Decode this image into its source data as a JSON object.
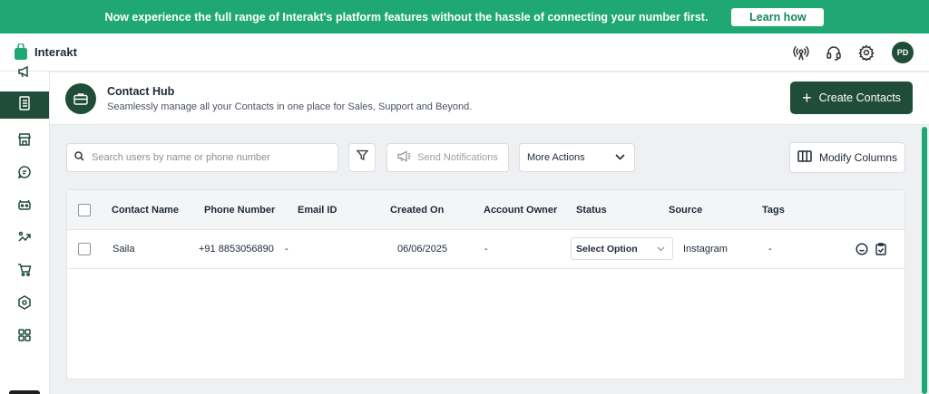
{
  "banner": {
    "text": "Now experience the full range of Interakt's platform features without the hassle of connecting your number first.",
    "cta": "Learn how"
  },
  "app": {
    "name": "Interakt"
  },
  "user": {
    "initials": "PD"
  },
  "topbar": {
    "icons": [
      "broadcast-icon",
      "headset-icon",
      "gear-icon"
    ]
  },
  "sidebar": {
    "items": [
      {
        "icon": "campaign-icon",
        "active": false
      },
      {
        "icon": "contacts-book-icon",
        "active": true
      },
      {
        "icon": "store-icon",
        "active": false
      },
      {
        "icon": "chat-icon",
        "active": false
      },
      {
        "icon": "bot-icon",
        "active": false
      },
      {
        "icon": "growth-icon",
        "active": false
      },
      {
        "icon": "cart-icon",
        "active": false
      },
      {
        "icon": "integration-hexagon-icon",
        "active": false
      },
      {
        "icon": "apps-grid-icon",
        "active": false
      }
    ]
  },
  "header": {
    "title": "Contact Hub",
    "subtitle": "Seamlessly manage all your Contacts in one place for Sales, Support and Beyond.",
    "create_button": "Create Contacts"
  },
  "toolbar": {
    "search_placeholder": "Search users by name or phone number",
    "send_notifications": "Send Notifications",
    "more_actions": "More Actions",
    "modify_columns": "Modify Columns"
  },
  "table": {
    "columns": [
      "Contact Name",
      "Phone Number",
      "Email ID",
      "Created On",
      "Account Owner",
      "Status",
      "Source",
      "Tags"
    ],
    "rows": [
      {
        "name": "Saila",
        "phone": "+91 8853056890",
        "email": "-",
        "created_on": "06/06/2025",
        "account_owner": "-",
        "status": "Select Option",
        "source": "Instagram",
        "tags": "-"
      }
    ]
  },
  "colors": {
    "brand_green": "#1fa873",
    "dark_green": "#1f4d3a"
  }
}
